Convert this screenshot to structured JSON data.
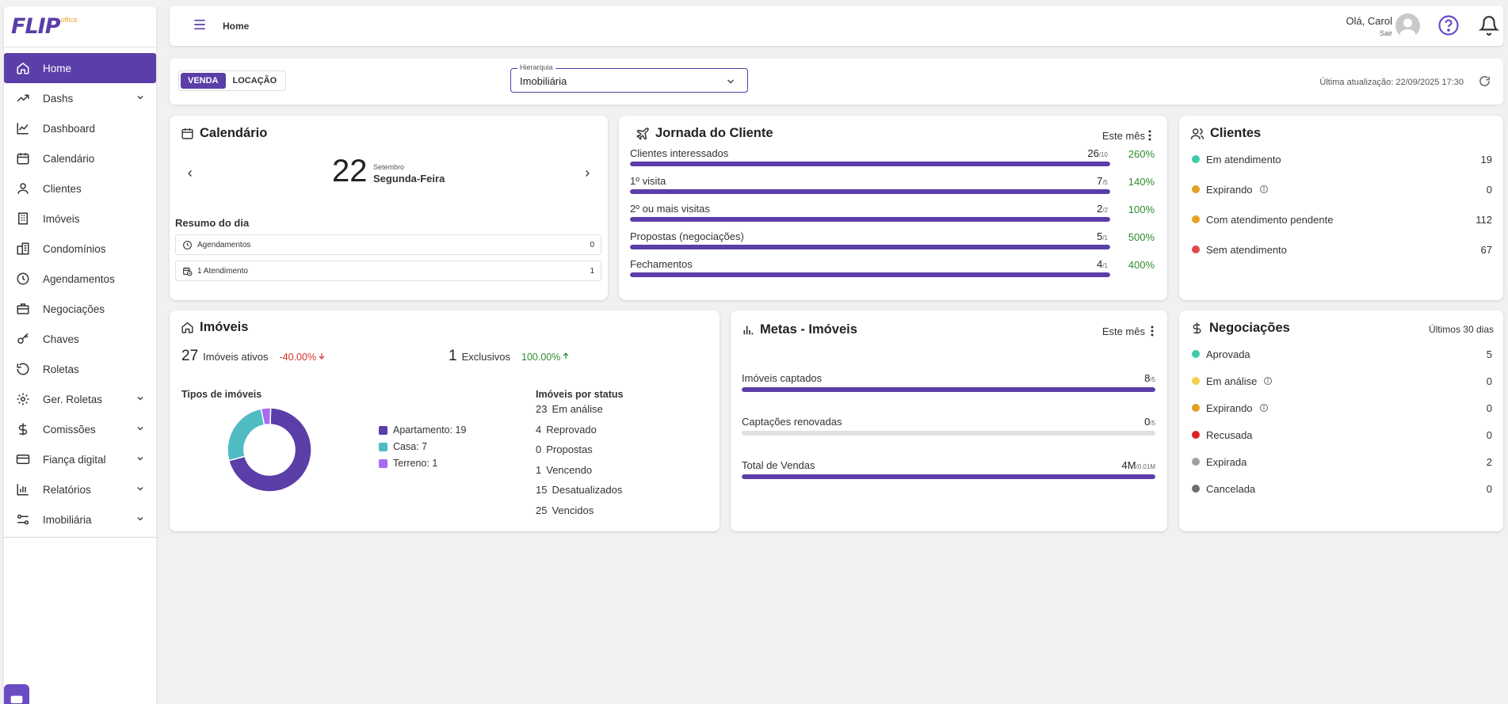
{
  "app": {
    "logo": "FLIP",
    "logo_sup": "office"
  },
  "sidebar": {
    "items": [
      {
        "label": "Home"
      },
      {
        "label": "Dashs"
      },
      {
        "label": "Dashboard"
      },
      {
        "label": "Calendário"
      },
      {
        "label": "Clientes"
      },
      {
        "label": "Imóveis"
      },
      {
        "label": "Condomínios"
      },
      {
        "label": "Agendamentos"
      },
      {
        "label": "Negociações"
      },
      {
        "label": "Chaves"
      },
      {
        "label": "Roletas"
      },
      {
        "label": "Ger. Roletas"
      },
      {
        "label": "Comissões"
      },
      {
        "label": "Fiança digital"
      },
      {
        "label": "Relatórios"
      },
      {
        "label": "Imobiliária"
      }
    ]
  },
  "header": {
    "breadcrumb": "Home",
    "greeting": "Olá, Carol",
    "logout": "Sair"
  },
  "filters": {
    "venda": "VENDA",
    "locacao": "LOCAÇÃO",
    "hierarquia_label": "Hierarquia",
    "hierarquia_value": "Imobiliária",
    "last_update": "Última atualização: 22/09/2025 17:30"
  },
  "calendario": {
    "title": "Calendário",
    "day": "22",
    "month": "Setembro",
    "weekday": "Segunda-Feira",
    "resumo_title": "Resumo do dia",
    "rows": [
      {
        "label": "Agendamentos",
        "count": "0"
      },
      {
        "label": "1 Atendimento",
        "count": "1"
      }
    ]
  },
  "jornada": {
    "title": "Jornada do Cliente",
    "period": "Este mês",
    "rows": [
      {
        "label": "Clientes interessados",
        "value": "26",
        "target": "/10",
        "pct": "260%",
        "fill": 1.0
      },
      {
        "label": "1º visita",
        "value": "7",
        "target": "/5",
        "pct": "140%",
        "fill": 1.0
      },
      {
        "label": "2º ou mais visitas",
        "value": "2",
        "target": "/2",
        "pct": "100%",
        "fill": 1.0
      },
      {
        "label": "Propostas (negociações)",
        "value": "5",
        "target": "/1",
        "pct": "500%",
        "fill": 1.0
      },
      {
        "label": "Fechamentos",
        "value": "4",
        "target": "/1",
        "pct": "400%",
        "fill": 1.0
      }
    ]
  },
  "clientes": {
    "title": "Clientes",
    "rows": [
      {
        "label": "Em atendimento",
        "value": "19",
        "color": "#3ec9a7"
      },
      {
        "label": "Expirando",
        "value": "0",
        "color": "#e0a020"
      },
      {
        "label": "Com atendimento pendente",
        "value": "112",
        "color": "#e8a020"
      },
      {
        "label": "Sem atendimento",
        "value": "67",
        "color": "#e04848"
      }
    ]
  },
  "imoveis": {
    "title": "Imóveis",
    "ativos_num": "27",
    "ativos_label": "Imóveis ativos",
    "ativos_pct": "-40.00%",
    "exclusivos_num": "1",
    "exclusivos_label": "Exclusivos",
    "exclusivos_pct": "100.00%",
    "tipos_title": "Tipos de imóveis",
    "status_title": "Imóveis por status",
    "status": [
      {
        "n": "23",
        "label": "Em análise"
      },
      {
        "n": "4",
        "label": "Reprovado"
      },
      {
        "n": "0",
        "label": "Propostas"
      },
      {
        "n": "1",
        "label": "Vencendo"
      },
      {
        "n": "15",
        "label": "Desatualizados"
      },
      {
        "n": "25",
        "label": "Vencidos"
      }
    ]
  },
  "chart_data": {
    "type": "pie",
    "categories": [
      "Apartamento",
      "Casa",
      "Terreno"
    ],
    "values": [
      19,
      7,
      1
    ],
    "legend": [
      "Apartamento: 19",
      "Casa: 7",
      "Terreno: 1"
    ],
    "colors": [
      "#5b3ea8",
      "#4fbcc4",
      "#a66cf0"
    ],
    "title": "Tipos de imóveis"
  },
  "metas": {
    "title": "Metas - Imóveis",
    "period": "Este mês",
    "rows": [
      {
        "label": "Imóveis captados",
        "value": "8",
        "target": "/5",
        "fill": 1.0
      },
      {
        "label": "Captações renovadas",
        "value": "0",
        "target": "/5",
        "fill": 0.0
      },
      {
        "label": "Total de Vendas",
        "value": "4M",
        "target": "/0.01M",
        "fill": 1.0
      }
    ]
  },
  "negociacoes": {
    "title": "Negociações",
    "period": "Últimos 30 dias",
    "rows": [
      {
        "label": "Aprovada",
        "value": "5",
        "color": "#3ec9a7"
      },
      {
        "label": "Em análise",
        "value": "0",
        "color": "#f2d04a"
      },
      {
        "label": "Expirando",
        "value": "0",
        "color": "#e0a020"
      },
      {
        "label": "Recusada",
        "value": "0",
        "color": "#e02020"
      },
      {
        "label": "Expirada",
        "value": "2",
        "color": "#a0a0a0"
      },
      {
        "label": "Cancelada",
        "value": "0",
        "color": "#6e6e6e"
      }
    ]
  }
}
